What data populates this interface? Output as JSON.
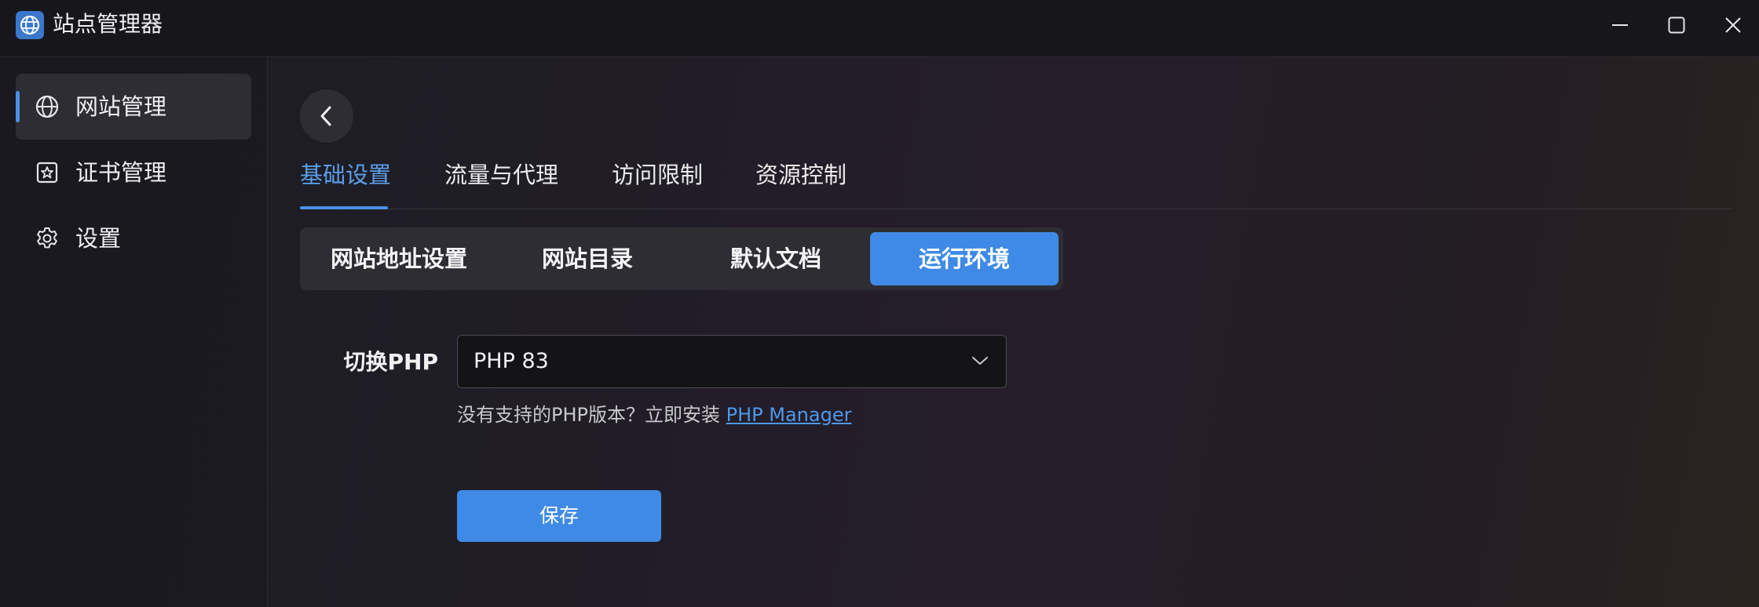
{
  "window": {
    "title": "站点管理器",
    "controls": [
      "minimize",
      "maximize",
      "close"
    ]
  },
  "sidebar": {
    "items": [
      {
        "label": "网站管理",
        "icon": "globe-icon",
        "active": true
      },
      {
        "label": "证书管理",
        "icon": "certificate-icon",
        "active": false
      },
      {
        "label": "设置",
        "icon": "gear-icon",
        "active": false
      }
    ]
  },
  "tabs": [
    {
      "label": "基础设置",
      "active": true
    },
    {
      "label": "流量与代理",
      "active": false
    },
    {
      "label": "访问限制",
      "active": false
    },
    {
      "label": "资源控制",
      "active": false
    }
  ],
  "segments": [
    {
      "label": "网站地址设置",
      "active": false
    },
    {
      "label": "网站目录",
      "active": false
    },
    {
      "label": "默认文档",
      "active": false
    },
    {
      "label": "运行环境",
      "active": true
    }
  ],
  "form": {
    "php_label": "切换PHP",
    "php_value": "PHP 83",
    "hint_text": "没有支持的PHP版本？立即安装 ",
    "hint_link": "PHP Manager",
    "save_label": "保存"
  },
  "colors": {
    "accent": "#3f8ae6",
    "link": "#4f97ea",
    "titlebar": "#17171b",
    "panel": "#2e2d34"
  }
}
